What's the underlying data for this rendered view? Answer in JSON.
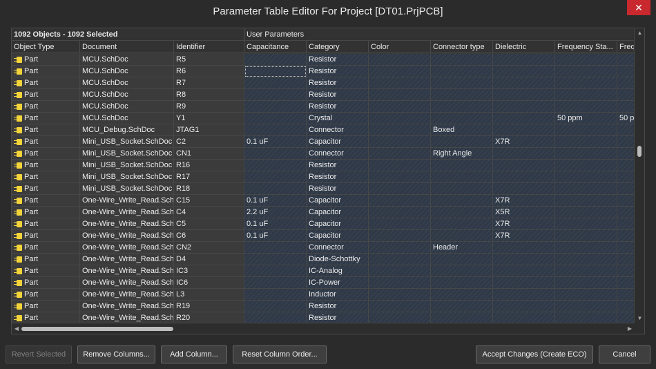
{
  "window": {
    "title": "Parameter Table Editor For Project [DT01.PrjPCB]",
    "close_glyph": "✕"
  },
  "grid": {
    "selection_summary": "1092 Objects - 1092 Selected",
    "user_params_label": "User Parameters",
    "columns": [
      "Object Type",
      "Document",
      "Identifier",
      "Capacitance",
      "Category",
      "Color",
      "Connector type",
      "Dielectric",
      "Frequency Sta...",
      "Freq"
    ],
    "rows": [
      [
        "Part",
        "MCU.SchDoc",
        "R5",
        "",
        "Resistor",
        "",
        "",
        "",
        "",
        ""
      ],
      [
        "Part",
        "MCU.SchDoc",
        "R6",
        "",
        "Resistor",
        "",
        "",
        "",
        "",
        ""
      ],
      [
        "Part",
        "MCU.SchDoc",
        "R7",
        "",
        "Resistor",
        "",
        "",
        "",
        "",
        ""
      ],
      [
        "Part",
        "MCU.SchDoc",
        "R8",
        "",
        "Resistor",
        "",
        "",
        "",
        "",
        ""
      ],
      [
        "Part",
        "MCU.SchDoc",
        "R9",
        "",
        "Resistor",
        "",
        "",
        "",
        "",
        ""
      ],
      [
        "Part",
        "MCU.SchDoc",
        "Y1",
        "",
        "Crystal",
        "",
        "",
        "",
        "50 ppm",
        "50 p"
      ],
      [
        "Part",
        "MCU_Debug.SchDoc",
        "JTAG1",
        "",
        "Connector",
        "",
        "Boxed",
        "",
        "",
        ""
      ],
      [
        "Part",
        "Mini_USB_Socket.SchDoc",
        "C2",
        "0.1 uF",
        "Capacitor",
        "",
        "",
        "X7R",
        "",
        ""
      ],
      [
        "Part",
        "Mini_USB_Socket.SchDoc",
        "CN1",
        "",
        "Connector",
        "",
        "Right Angle",
        "",
        "",
        ""
      ],
      [
        "Part",
        "Mini_USB_Socket.SchDoc",
        "R16",
        "",
        "Resistor",
        "",
        "",
        "",
        "",
        ""
      ],
      [
        "Part",
        "Mini_USB_Socket.SchDoc",
        "R17",
        "",
        "Resistor",
        "",
        "",
        "",
        "",
        ""
      ],
      [
        "Part",
        "Mini_USB_Socket.SchDoc",
        "R18",
        "",
        "Resistor",
        "",
        "",
        "",
        "",
        ""
      ],
      [
        "Part",
        "One-Wire_Write_Read.SchDoc",
        "C15",
        "0.1 uF",
        "Capacitor",
        "",
        "",
        "X7R",
        "",
        ""
      ],
      [
        "Part",
        "One-Wire_Write_Read.SchDoc",
        "C4",
        "2.2 uF",
        "Capacitor",
        "",
        "",
        "X5R",
        "",
        ""
      ],
      [
        "Part",
        "One-Wire_Write_Read.SchDoc",
        "C5",
        "0.1 uF",
        "Capacitor",
        "",
        "",
        "X7R",
        "",
        ""
      ],
      [
        "Part",
        "One-Wire_Write_Read.SchDoc",
        "C6",
        "0.1 uF",
        "Capacitor",
        "",
        "",
        "X7R",
        "",
        ""
      ],
      [
        "Part",
        "One-Wire_Write_Read.SchDoc",
        "CN2",
        "",
        "Connector",
        "",
        "Header",
        "",
        "",
        ""
      ],
      [
        "Part",
        "One-Wire_Write_Read.SchDoc",
        "D4",
        "",
        "Diode-Schottky",
        "",
        "",
        "",
        "",
        ""
      ],
      [
        "Part",
        "One-Wire_Write_Read.SchDoc",
        "IC3",
        "",
        "IC-Analog",
        "",
        "",
        "",
        "",
        ""
      ],
      [
        "Part",
        "One-Wire_Write_Read.SchDoc",
        "IC6",
        "",
        "IC-Power",
        "",
        "",
        "",
        "",
        ""
      ],
      [
        "Part",
        "One-Wire_Write_Read.SchDoc",
        "L3",
        "",
        "Inductor",
        "",
        "",
        "",
        "",
        ""
      ],
      [
        "Part",
        "One-Wire_Write_Read.SchDoc",
        "R19",
        "",
        "Resistor",
        "",
        "",
        "",
        "",
        ""
      ],
      [
        "Part",
        "One-Wire_Write_Read.SchDoc",
        "R20",
        "",
        "Resistor",
        "",
        "",
        "",
        "",
        ""
      ]
    ]
  },
  "buttons": {
    "revert_selected": "Revert Selected",
    "remove_columns": "Remove Columns...",
    "add_column": "Add Column...",
    "reset_column_order": "Reset Column Order...",
    "accept_changes": "Accept Changes (Create ECO)",
    "cancel": "Cancel"
  },
  "colors": {
    "accent_close": "#c8282e",
    "part_icon": "#f2d33a",
    "param_cell": "#2f3947"
  }
}
